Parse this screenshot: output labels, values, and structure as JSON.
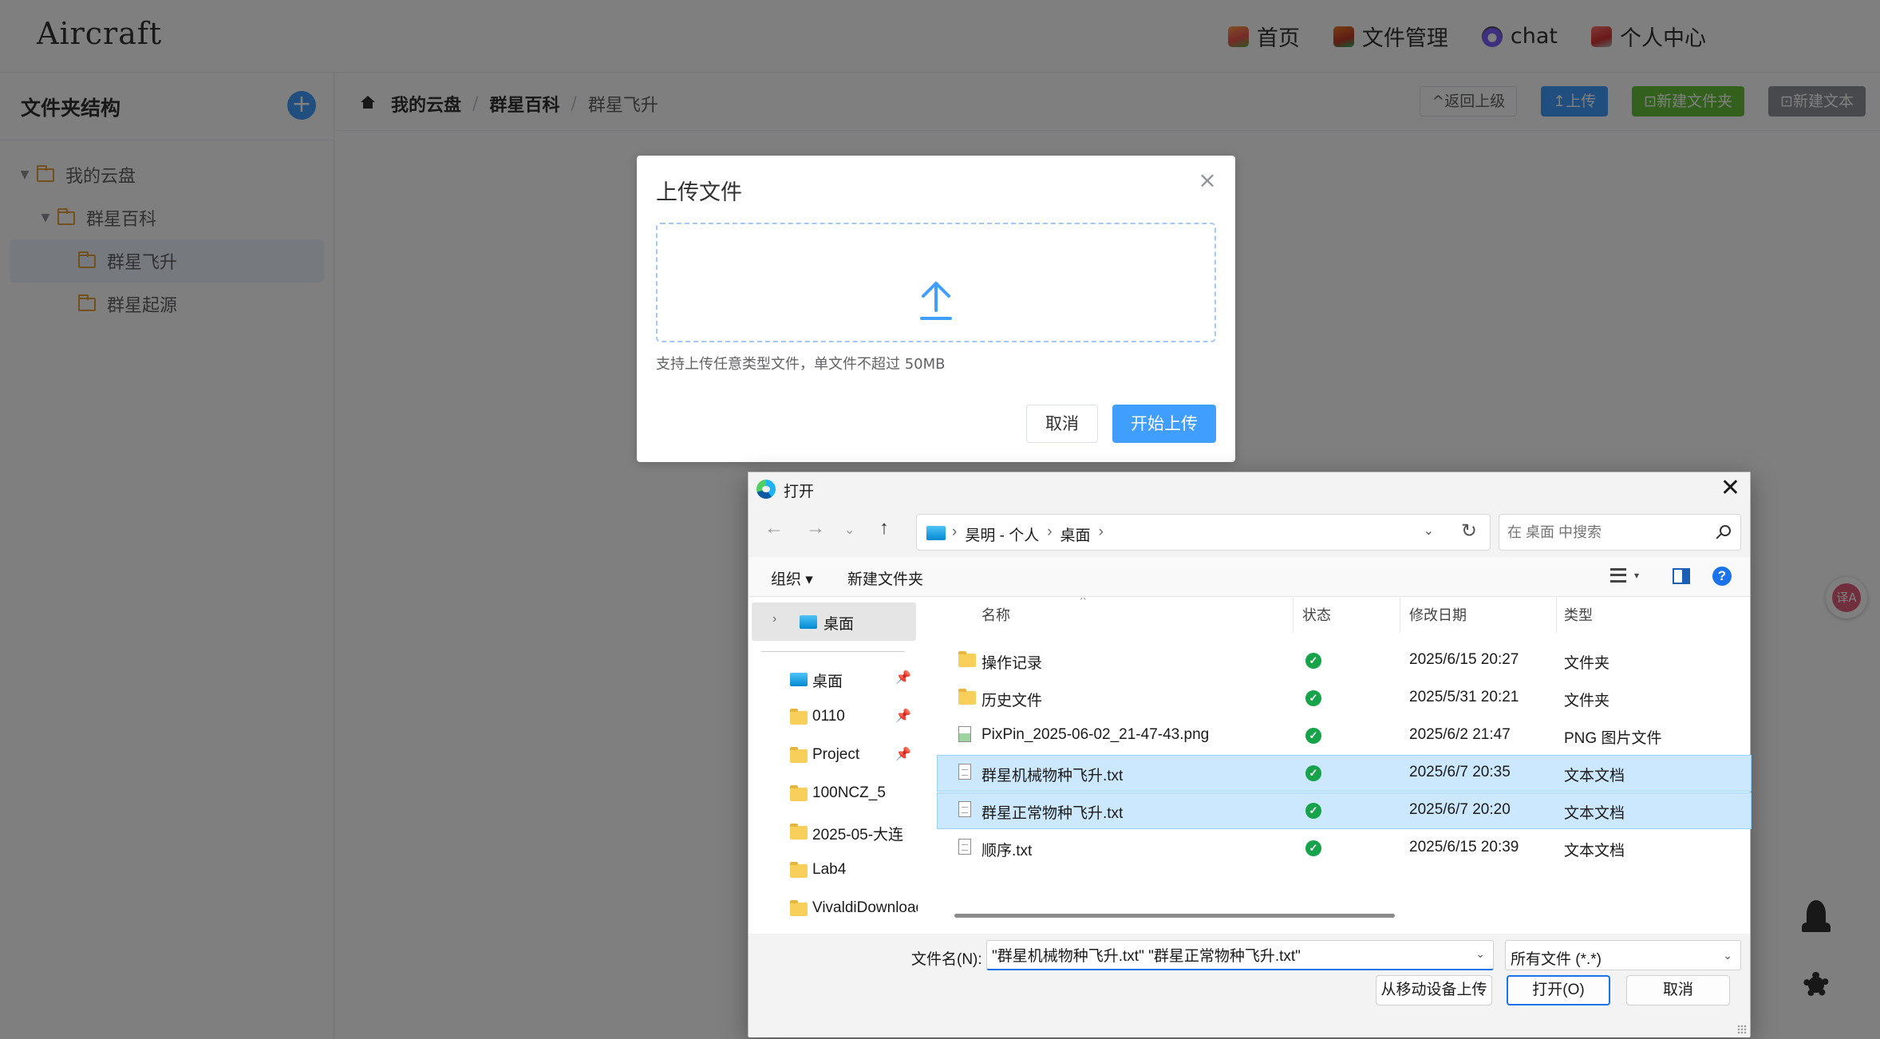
{
  "app": {
    "brand": "Aircraft",
    "nav": [
      {
        "label": "首页",
        "icon": "home-icon"
      },
      {
        "label": "文件管理",
        "icon": "files-icon"
      },
      {
        "label": "chat",
        "icon": "chat-icon"
      },
      {
        "label": "个人中心",
        "icon": "user-icon"
      }
    ]
  },
  "sidebar": {
    "title": "文件夹结构",
    "add_icon": "plus-icon",
    "tree": [
      {
        "label": "我的云盘",
        "level": 0,
        "expanded": true
      },
      {
        "label": "群星百科",
        "level": 1,
        "expanded": true
      },
      {
        "label": "群星飞升",
        "level": 2,
        "active": true
      },
      {
        "label": "群星起源",
        "level": 2
      }
    ]
  },
  "breadcrumb": {
    "items": [
      "我的云盘",
      "群星百科",
      "群星飞升"
    ],
    "separator": "/"
  },
  "toolbar": {
    "back": "^返回上级",
    "upload": "↥上传",
    "new_folder": "⊡新建文件夹",
    "new_text": "⊡新建文本"
  },
  "upload_modal": {
    "title": "上传文件",
    "close": "×",
    "tip": "支持上传任意类型文件，单文件不超过 50MB",
    "cancel": "取消",
    "start": "开始上传"
  },
  "file_dialog": {
    "title": "打开",
    "close": "✕",
    "address": [
      "昊明 - 个人",
      "桌面"
    ],
    "search_placeholder": "在 桌面 中搜索",
    "organize": "组织 ▾",
    "new_folder": "新建文件夹",
    "help": "?",
    "nav_tree_top": "桌面",
    "quick_access": [
      {
        "label": "桌面",
        "icon": "desktop-icon",
        "pinned": true
      },
      {
        "label": "0110",
        "icon": "folder-icon",
        "pinned": true
      },
      {
        "label": "Project",
        "icon": "folder-icon",
        "pinned": true
      },
      {
        "label": "100NCZ_5",
        "icon": "folder-icon"
      },
      {
        "label": "2025-05-大连",
        "icon": "folder-icon"
      },
      {
        "label": "Lab4",
        "icon": "folder-icon"
      },
      {
        "label": "VivaldiDownloads",
        "icon": "folder-icon"
      }
    ],
    "columns": {
      "name": "名称",
      "status": "状态",
      "date": "修改日期",
      "type": "类型"
    },
    "files": [
      {
        "name": "操作记录",
        "date": "2025/6/15 20:27",
        "type": "文件夹",
        "icon": "folder-icon",
        "selected": false
      },
      {
        "name": "历史文件",
        "date": "2025/5/31 20:21",
        "type": "文件夹",
        "icon": "folder-icon",
        "selected": false
      },
      {
        "name": "PixPin_2025-06-02_21-47-43.png",
        "date": "2025/6/2 21:47",
        "type": "PNG 图片文件",
        "icon": "png-icon",
        "selected": false
      },
      {
        "name": "群星机械物种飞升.txt",
        "date": "2025/6/7 20:35",
        "type": "文本文档",
        "icon": "text-file-icon",
        "selected": true
      },
      {
        "name": "群星正常物种飞升.txt",
        "date": "2025/6/7 20:20",
        "type": "文本文档",
        "icon": "text-file-icon",
        "selected": true
      },
      {
        "name": "顺序.txt",
        "date": "2025/6/15 20:39",
        "type": "文本文档",
        "icon": "text-file-icon",
        "selected": false
      }
    ],
    "filename_label": "文件名(N):",
    "filename_value": "\"群星机械物种飞升.txt\" \"群星正常物种飞升.txt\"",
    "filter": "所有文件 (*.*)",
    "mobile_upload": "从移动设备上传",
    "open": "打开(O)",
    "cancel": "取消"
  },
  "colors": {
    "accent": "#409eff",
    "success": "#67c23a",
    "info": "#909399",
    "win_select": "#cce8ff"
  }
}
